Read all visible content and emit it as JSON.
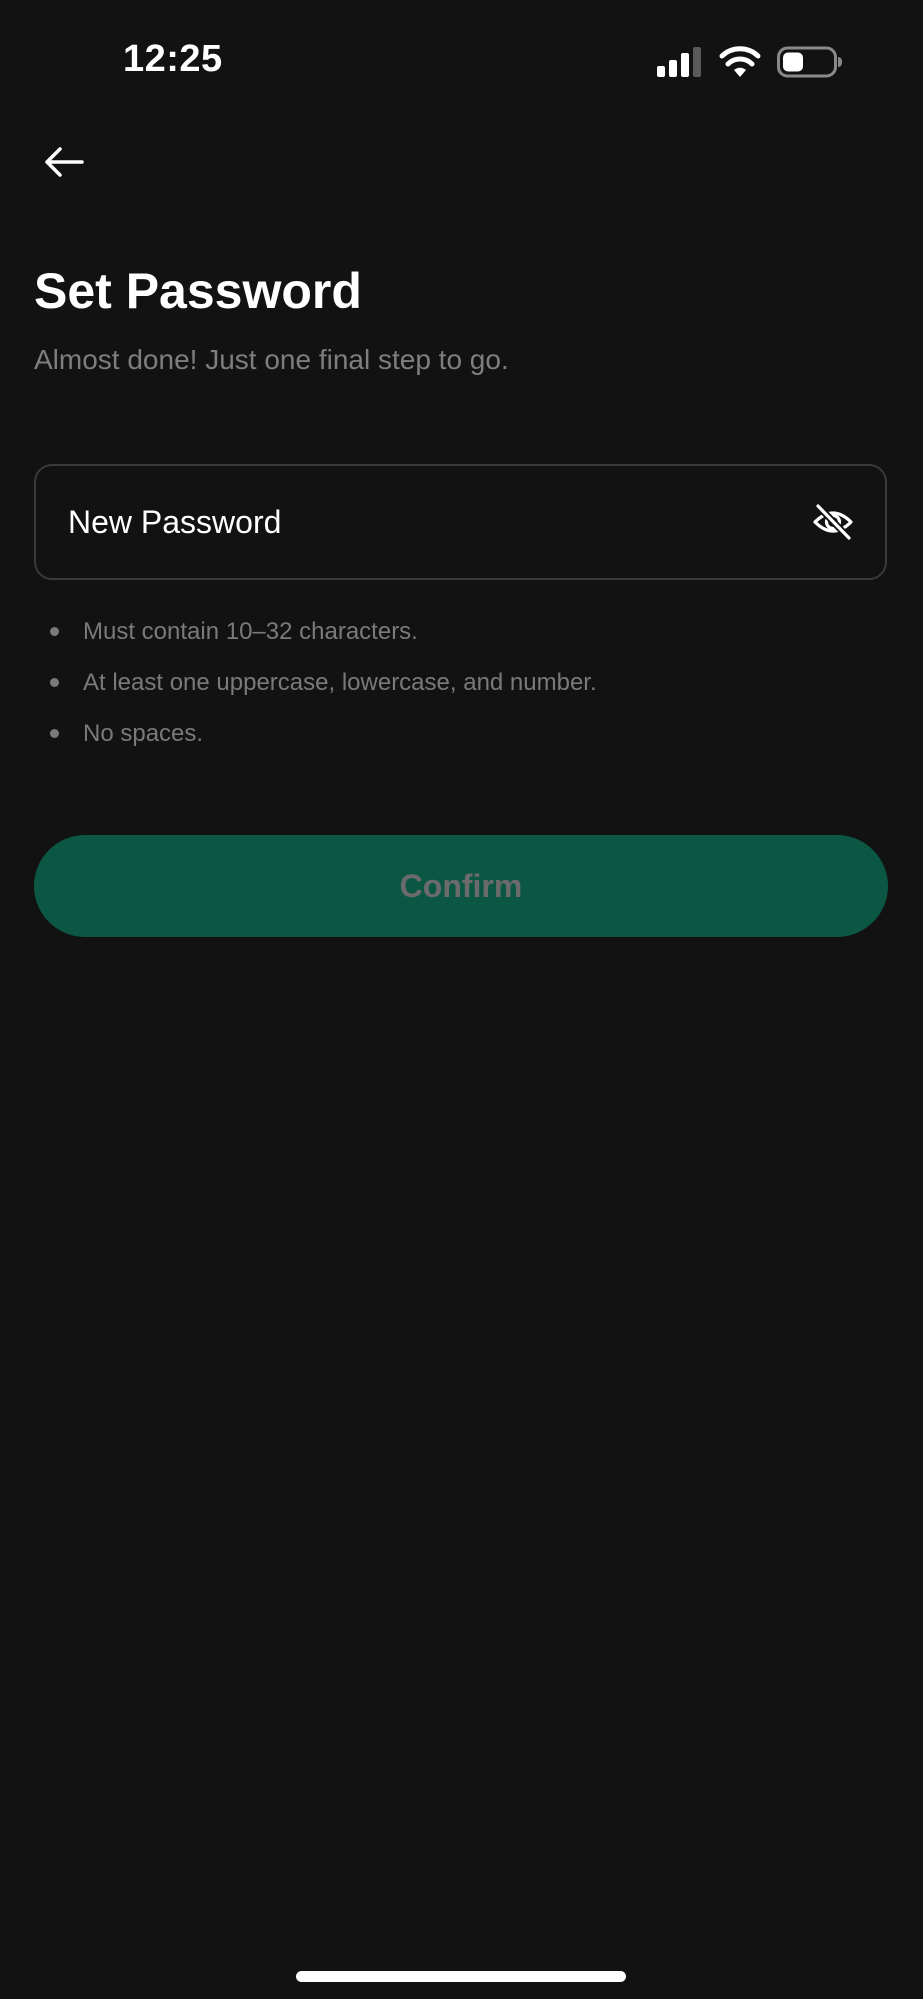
{
  "status_bar": {
    "time": "12:25",
    "icons": [
      "cellular-signal-icon",
      "wifi-icon",
      "battery-icon"
    ]
  },
  "header": {
    "back_icon": "arrow-left-icon"
  },
  "main": {
    "title": "Set Password",
    "subtitle": "Almost done! Just one final step to go.",
    "password_field": {
      "placeholder": "New Password",
      "value": "",
      "toggle_icon": "eye-off-icon"
    },
    "rules": [
      "Must contain 10–32 characters.",
      "At least one uppercase, lowercase, and number.",
      "No spaces."
    ],
    "confirm_label": "Confirm"
  },
  "colors": {
    "background": "#121212",
    "accent_button": "#0b5744",
    "button_text_disabled": "#6b6b6b",
    "muted_text": "#7a7a7a",
    "field_border": "#3a3a3a"
  }
}
